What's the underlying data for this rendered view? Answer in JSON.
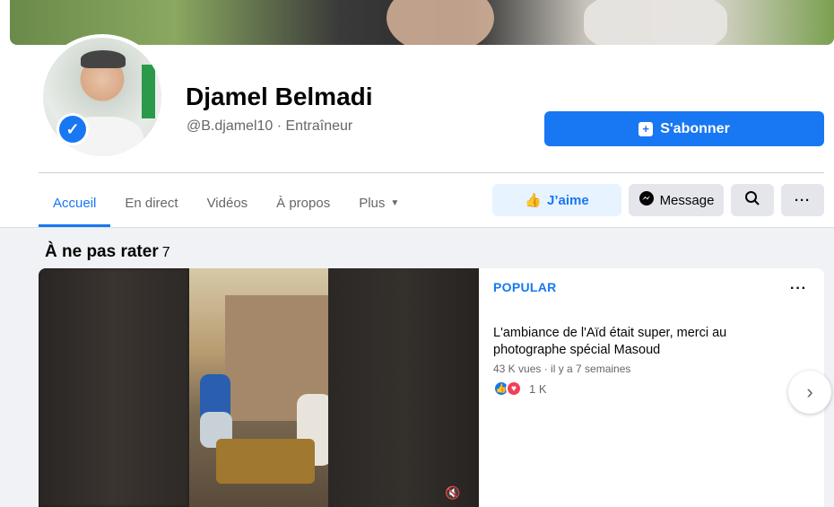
{
  "profile": {
    "name": "Djamel Belmadi",
    "handle": "@B.djamel10 · Entraîneur",
    "subscribe_label": "S'abonner"
  },
  "tabs": [
    {
      "label": "Accueil",
      "active": true
    },
    {
      "label": "En direct"
    },
    {
      "label": "Vidéos"
    },
    {
      "label": "À propos"
    },
    {
      "label": "Plus"
    }
  ],
  "actions": {
    "like_label": "J’aime",
    "message_label": "Message"
  },
  "section": {
    "title": "À ne pas rater",
    "count": "7"
  },
  "card": {
    "badge": "POPULAR",
    "description": "L'ambiance de l'Aïd était super, merci au photographe spécial Masoud",
    "meta": "43 K vues · il y a 7 semaines",
    "reaction_count": "1 K"
  },
  "icons": [
    "verified-icon",
    "subscribe-icon",
    "like-icon",
    "messenger-icon",
    "search-icon",
    "more-icon",
    "chevron-down-icon",
    "mute-icon",
    "love-icon",
    "chevron-right-icon"
  ],
  "colors": {
    "accent": "#1877f2",
    "background": "#f0f2f5"
  }
}
